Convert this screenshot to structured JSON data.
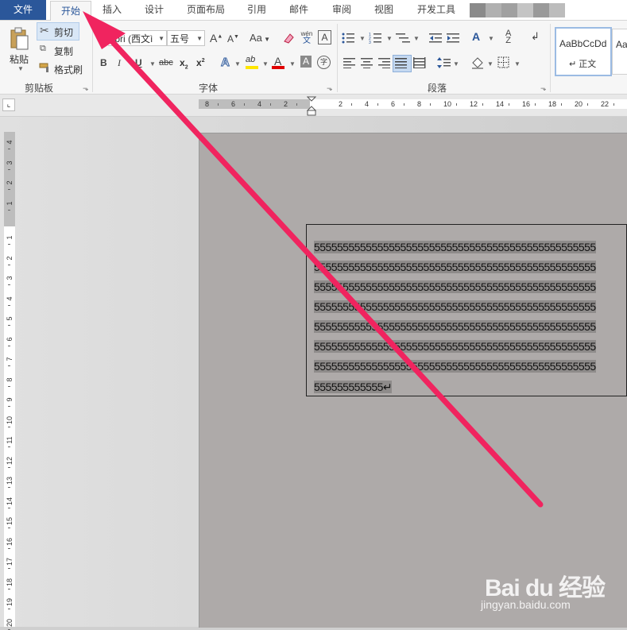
{
  "tabs": [
    "文件",
    "开始",
    "插入",
    "设计",
    "页面布局",
    "引用",
    "邮件",
    "审阅",
    "视图",
    "开发工具"
  ],
  "clipboard": {
    "paste": "粘贴",
    "cut": "剪切",
    "copy": "复制",
    "format_painter": "格式刷",
    "group_label": "剪贴板"
  },
  "font": {
    "font_name": "libri (西文ì",
    "font_size": "五号",
    "grow": "A",
    "shrink": "A",
    "change_case": "Aa",
    "phonetic_top": "wén",
    "phonetic_bottom": "文",
    "border_char": "A",
    "bold": "B",
    "underline": "U",
    "strike": "abc",
    "subscript": "x",
    "superscript": "x",
    "text_effect": "A",
    "highlight": "ab",
    "font_color": "A",
    "shading": "A",
    "enclose": "字",
    "group_label": "字体"
  },
  "paragraph": {
    "group_label": "段落"
  },
  "styles": {
    "normal_preview": "AaBbCcDd",
    "normal_name": "↵ 正文",
    "next_preview": "Aa"
  },
  "ruler": {
    "h_numbers": [
      "8",
      "6",
      "4",
      "2",
      "2",
      "4",
      "6",
      "8",
      "10",
      "12",
      "14",
      "16",
      "18",
      "20",
      "22"
    ],
    "v_numbers": [
      "4",
      "3",
      "2",
      "1",
      "1",
      "2",
      "3",
      "4",
      "5",
      "6",
      "7",
      "8",
      "9",
      "10",
      "11",
      "12",
      "13",
      "14",
      "15",
      "16",
      "17",
      "18",
      "19",
      "20"
    ]
  },
  "document": {
    "lines": [
      "5555555555555555555555555555555555555555555555555",
      "5555555555555555555555555555555555555555555555555",
      "5555555555555555555555555555555555555555555555555",
      "5555555555555555555555555555555555555555555555555",
      "5555555555555555555555555555555555555555555555555",
      "5555555555555555555555555555555555555555555555555",
      "5555555555555555555555555555555555555555555555555",
      "555555555555↵"
    ]
  },
  "watermark": {
    "main": "Bai du 经验",
    "sub": "jingyan.baidu.com"
  },
  "colors": {
    "file_tab": "#2b579a",
    "arrow": "#f0245f",
    "highlight_bar": "#ffe600",
    "font_color_bar": "#e00000",
    "page": "#aeaaa9"
  },
  "icons": [
    "paste-icon",
    "scissors-icon",
    "copy-icon",
    "format-painter-icon",
    "clear-format-icon",
    "bullets-icon",
    "numbering-icon",
    "multilevel-icon",
    "decrease-indent-icon",
    "increase-indent-icon",
    "sort-icon",
    "show-marks-icon",
    "align-left-icon",
    "center-icon",
    "align-right-icon",
    "justify-icon",
    "distribute-icon",
    "line-spacing-icon",
    "shading-bucket-icon",
    "borders-icon"
  ]
}
